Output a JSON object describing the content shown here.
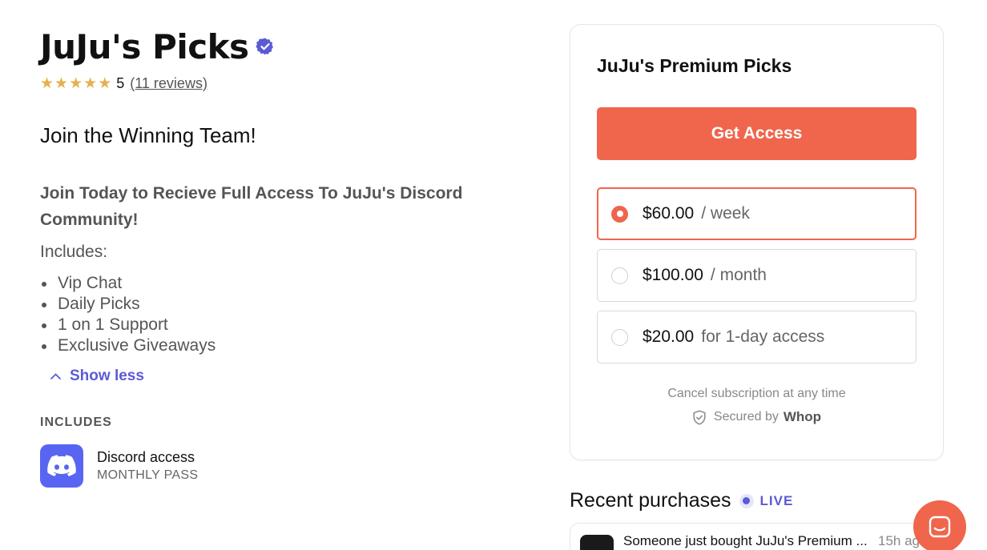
{
  "product": {
    "title": "JuJu's Picks",
    "verified_icon": "verified-badge-icon",
    "rating_value": "5",
    "rating_stars": 5,
    "reviews_label": "(11 reviews)",
    "tagline": "Join the Winning Team!",
    "headline": "Join Today to Recieve Full Access To JuJu's Discord Community!",
    "includes_intro": "Includes:",
    "bullets": [
      "Vip Chat",
      "Daily Picks",
      "1 on 1 Support",
      "Exclusive Giveaways"
    ],
    "show_less_label": "Show less"
  },
  "includes": {
    "section_label": "INCLUDES",
    "items": [
      {
        "name": "Discord access",
        "subtitle": "MONTHLY PASS",
        "icon": "discord-icon"
      }
    ]
  },
  "checkout": {
    "title": "JuJu's Premium Picks",
    "cta_label": "Get Access",
    "options": [
      {
        "price": "$60.00",
        "period": "/ week",
        "selected": true
      },
      {
        "price": "$100.00",
        "period": "/ month",
        "selected": false
      },
      {
        "price": "$20.00",
        "period": "for 1-day access",
        "selected": false
      }
    ],
    "cancel_note": "Cancel subscription at any time",
    "secured_label": "Secured by",
    "secured_brand": "Whop"
  },
  "recent": {
    "title": "Recent purchases",
    "live_label": "LIVE",
    "items": [
      {
        "text": "Someone just bought JuJu's Premium ...",
        "time": "15h ago"
      }
    ]
  },
  "colors": {
    "accent": "#ef664d",
    "link": "#5b5bd6",
    "star": "#e7b14f",
    "discord": "#5865f2"
  }
}
